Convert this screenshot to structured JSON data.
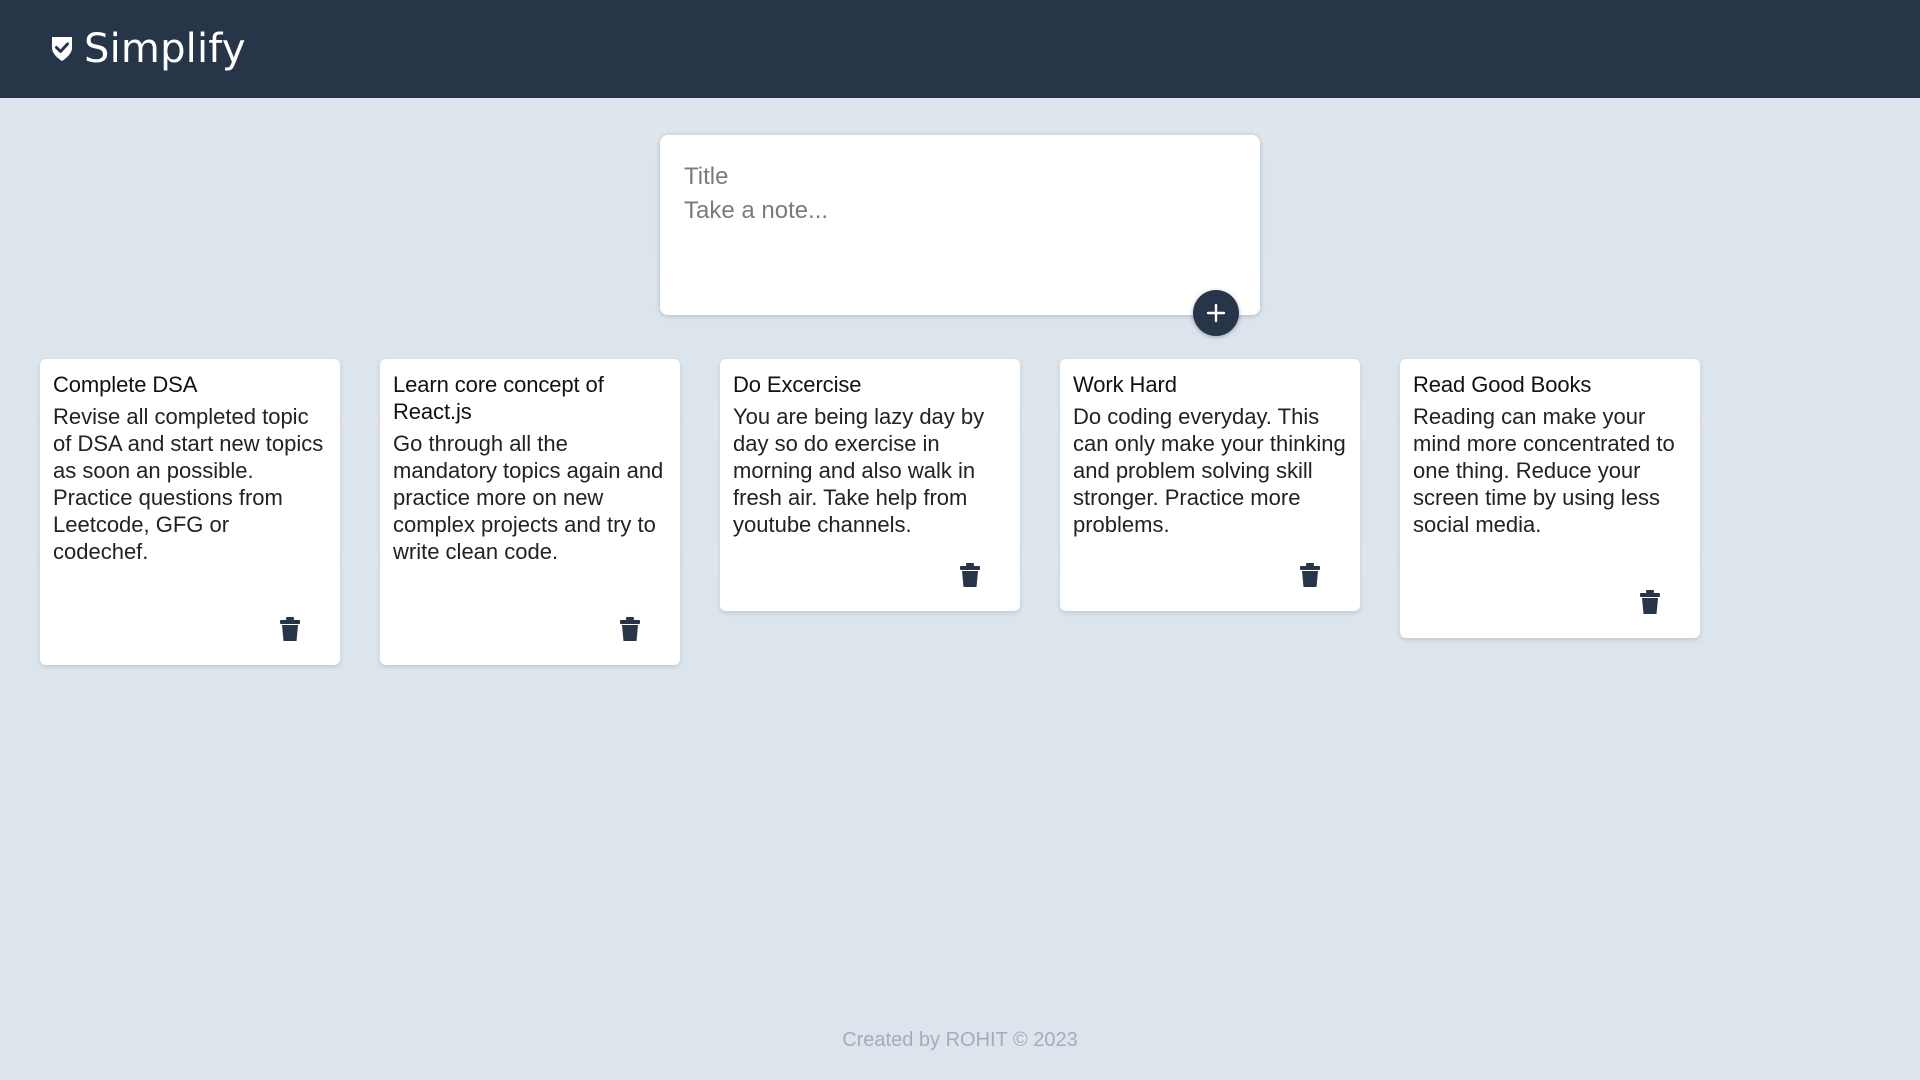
{
  "header": {
    "title": "Simplify",
    "logo_icon": "shield-check-icon"
  },
  "composer": {
    "title_placeholder": "Title",
    "body_placeholder": "Take a note...",
    "title_value": "",
    "body_value": "",
    "add_icon": "plus-icon"
  },
  "notes": [
    {
      "title": "Complete DSA",
      "text": "Revise all completed topic of DSA and start new topics as soon an possible. Practice questions from Leetcode, GFG or codechef."
    },
    {
      "title": "Learn core concept of React.js",
      "text": "Go through all the mandatory topics again and practice more on new complex projects and try to write clean code."
    },
    {
      "title": "Do Excercise",
      "text": "You are being lazy day by day so do exercise in morning and also walk in fresh air. Take help from youtube channels."
    },
    {
      "title": "Work Hard",
      "text": "Do coding everyday. This can only make your thinking and problem solving skill stronger. Practice more problems."
    },
    {
      "title": "Read Good Books",
      "text": "Reading can make your mind more concentrated to one thing. Reduce your screen time by using less social media."
    }
  ],
  "footer": {
    "text": "Created by ROHIT © 2023"
  },
  "colors": {
    "header_bg": "#263548",
    "page_bg": "#dce4ec",
    "card_bg": "#ffffff",
    "accent": "#263548",
    "footer_text": "#a1aebf"
  }
}
